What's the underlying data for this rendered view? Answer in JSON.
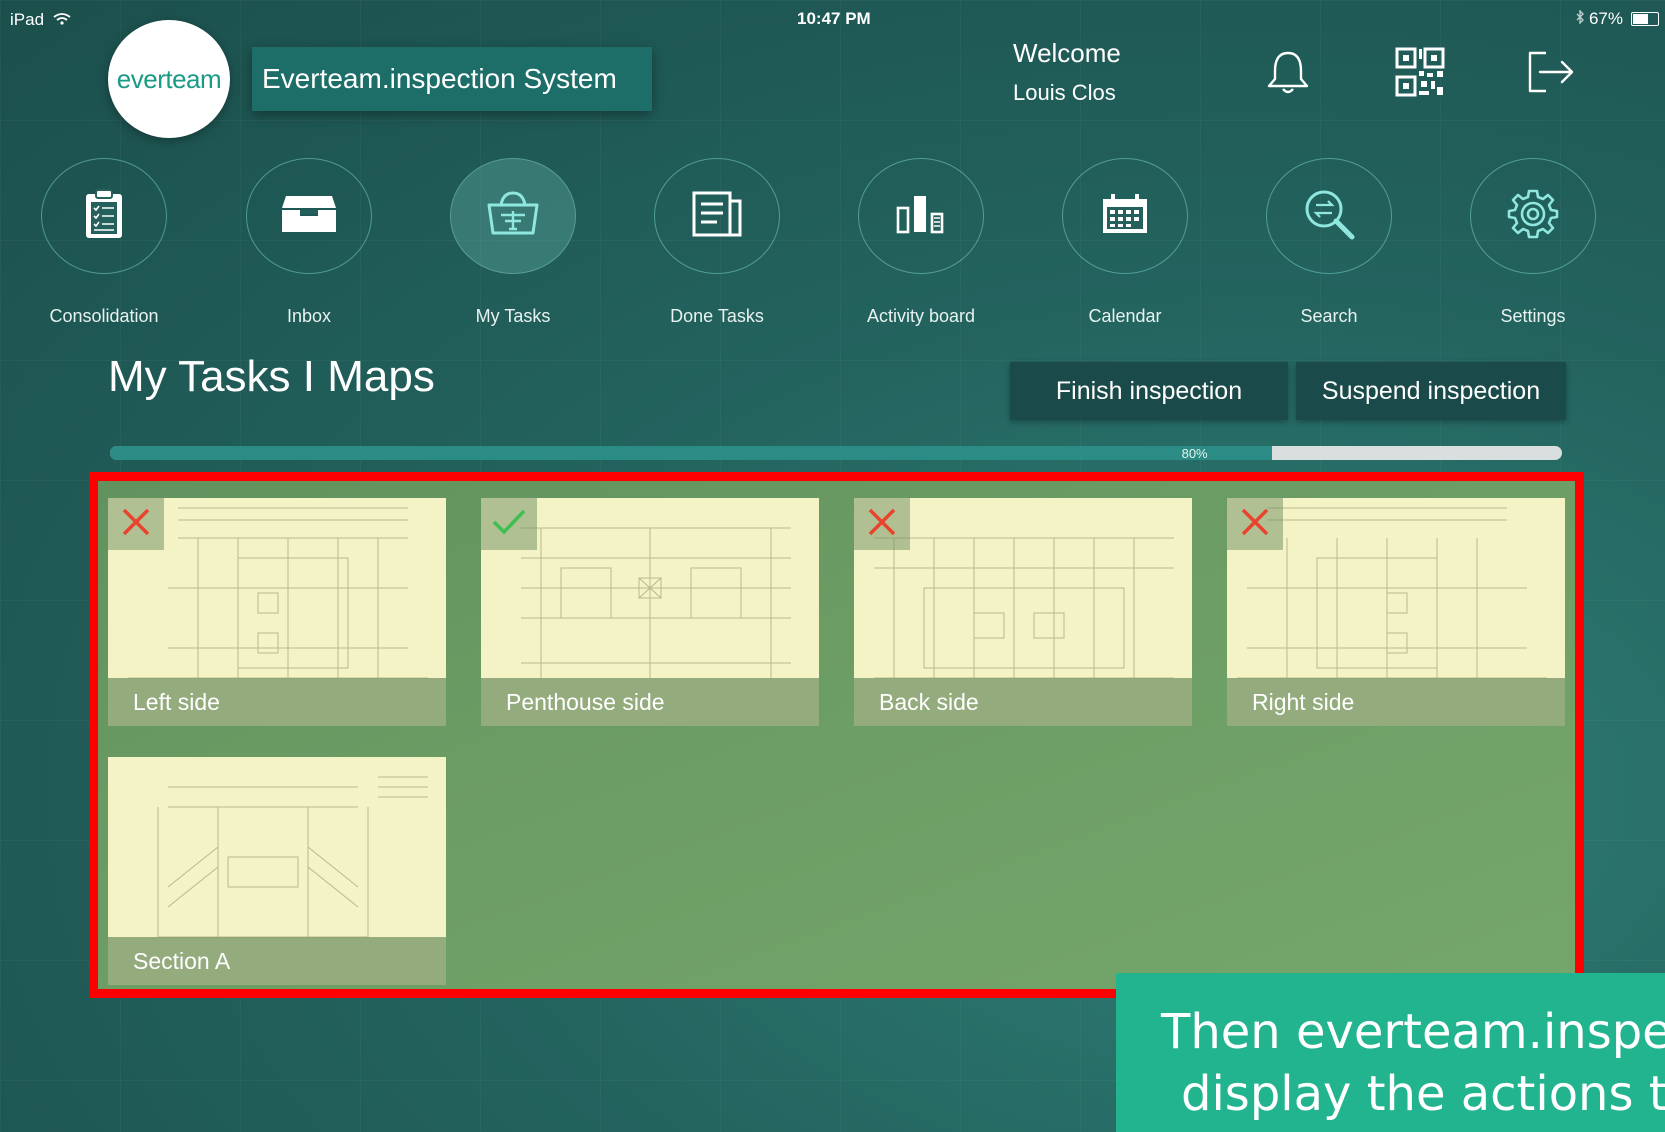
{
  "status_bar": {
    "device": "iPad",
    "time": "10:47 PM",
    "battery": "67%",
    "battery_level": 0.67
  },
  "header": {
    "logo_text": "everteam",
    "app_title": "Everteam.inspection System",
    "welcome": "Welcome",
    "username": "Louis Clos",
    "icons": [
      "bell-icon",
      "qr-code-icon",
      "logout-icon"
    ]
  },
  "nav": {
    "items": [
      {
        "label": "Consolidation",
        "icon": "clipboard-icon"
      },
      {
        "label": "Inbox",
        "icon": "inbox-tray-icon"
      },
      {
        "label": "My Tasks",
        "icon": "basket-icon",
        "active": true
      },
      {
        "label": "Done Tasks",
        "icon": "document-icon"
      },
      {
        "label": "Activity board",
        "icon": "bar-chart-icon"
      },
      {
        "label": "Calendar",
        "icon": "calendar-icon"
      },
      {
        "label": "Search",
        "icon": "search-icon"
      },
      {
        "label": "Settings",
        "icon": "gear-icon"
      }
    ]
  },
  "page": {
    "title": "My Tasks I Maps",
    "finish_label": "Finish inspection",
    "suspend_label": "Suspend inspection",
    "progress_label": "80%",
    "progress": 0.8
  },
  "maps": [
    {
      "label": "Left side",
      "status": "rejected"
    },
    {
      "label": "Penthouse side",
      "status": "done"
    },
    {
      "label": "Back side",
      "status": "rejected"
    },
    {
      "label": "Right side",
      "status": "rejected"
    },
    {
      "label": "Section A",
      "status": "none"
    }
  ],
  "callout": {
    "line1": "Then everteam.inspect",
    "line2": "display the actions tak"
  },
  "colors": {
    "accent": "#22b38f",
    "highlight_border": "#ff0000",
    "reject_mark": "#e8432c",
    "done_mark": "#3fbf4f"
  }
}
